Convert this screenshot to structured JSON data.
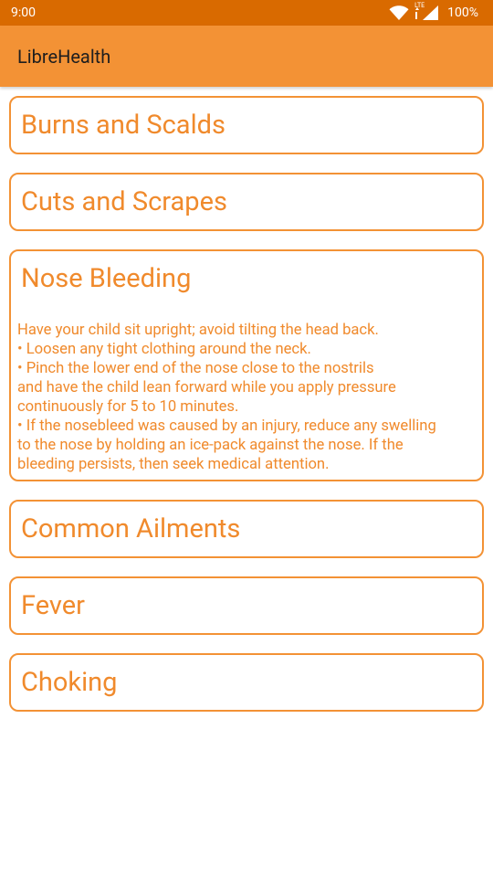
{
  "status_bar": {
    "time": "9:00",
    "network_label": "LTE",
    "battery": "100%",
    "icons": [
      "wifi-icon",
      "signal-icon"
    ]
  },
  "app_bar": {
    "title": "LibreHealth"
  },
  "cards": [
    {
      "title": "Burns and Scalds"
    },
    {
      "title": "Cuts and Scrapes"
    },
    {
      "title": "Nose Bleeding",
      "expanded": true,
      "body": [
        " Have your child sit upright; avoid tilting the head back.",
        "• Loosen any tight clothing around the neck.",
        "• Pinch the lower end of the nose close to the nostrils",
        "and have the child lean forward while you apply pressure",
        "continuously for 5 to 10 minutes.",
        "• If the nosebleed was caused by an injury, reduce any swelling",
        "to the nose by holding an ice-pack against the nose. If the",
        "bleeding persists, then seek medical attention."
      ]
    },
    {
      "title": "Common Ailments"
    },
    {
      "title": "Fever"
    },
    {
      "title": "Choking"
    }
  ],
  "colors": {
    "status_bar": "#d96a00",
    "app_bar": "#f39235",
    "accent_text": "#f08a2c",
    "card_border": "#f39235"
  }
}
